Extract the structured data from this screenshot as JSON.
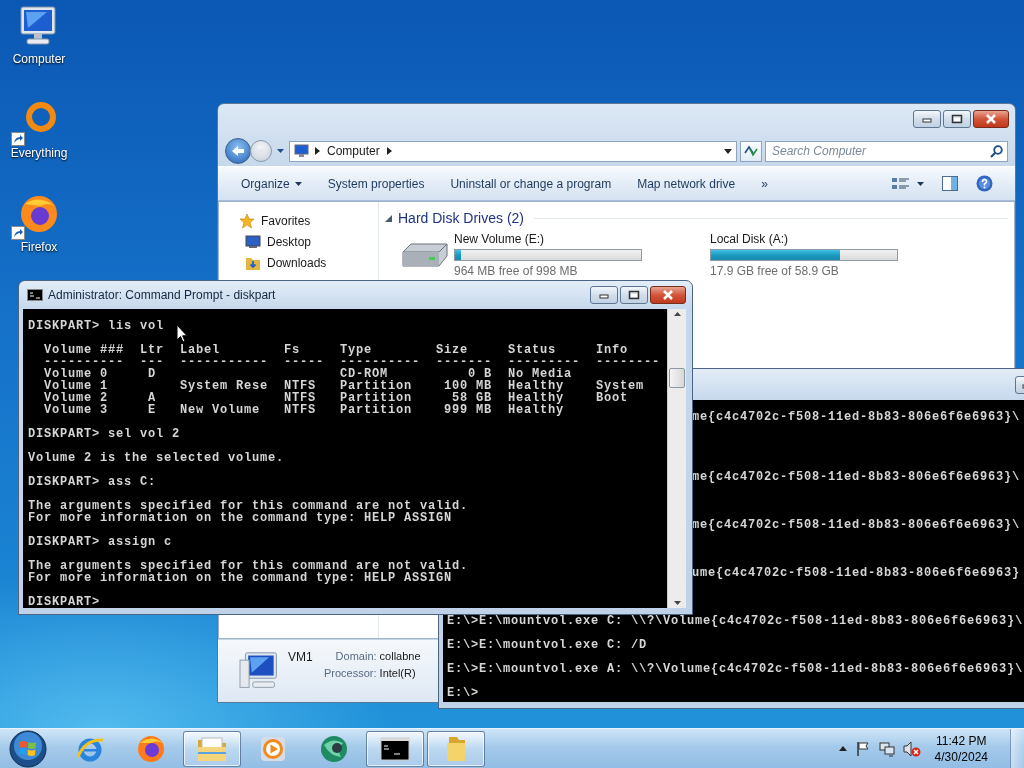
{
  "desktop_icons": [
    {
      "label": "Computer",
      "kind": "computer",
      "shortcut": false
    },
    {
      "label": "Everything",
      "kind": "everything",
      "shortcut": true
    },
    {
      "label": "Firefox",
      "kind": "firefox",
      "shortcut": true
    }
  ],
  "explorer": {
    "breadcrumbs": [
      "Computer"
    ],
    "search": {
      "placeholder": "Search Computer"
    },
    "toolbar": [
      {
        "label": "Organize",
        "dropdown": true
      },
      {
        "label": "System properties",
        "dropdown": false
      },
      {
        "label": "Uninstall or change a program",
        "dropdown": false
      },
      {
        "label": "Map network drive",
        "dropdown": false
      },
      {
        "label": "»",
        "dropdown": false
      }
    ],
    "toolbar_icons": [
      {
        "kind": "views"
      },
      {
        "kind": "preview-pane"
      },
      {
        "kind": "help"
      }
    ],
    "favorites": {
      "title": "Favorites",
      "items": [
        {
          "label": "Desktop",
          "kind": "desktop"
        },
        {
          "label": "Downloads",
          "kind": "downloads"
        }
      ]
    },
    "group": {
      "title": "Hard Disk Drives (2)",
      "expanded": true
    },
    "drives": [
      {
        "name": "New Volume (E:)",
        "icon": true,
        "level": 0.034,
        "free": "964 MB free of 998 MB"
      },
      {
        "name": "Local Disk (A:)",
        "icon": false,
        "level": 0.696,
        "free": "17.9 GB free of 58.9 GB"
      }
    ],
    "details": {
      "name": "VM1",
      "fields": [
        {
          "label": "Domain:",
          "value": "collabne"
        },
        {
          "label": "Processor:",
          "value": "Intel(R)"
        }
      ]
    }
  },
  "back_console": {
    "partial_lines": [
      "me{c4c4702c-f508-11ed-8b83-806e6f6e6963}\\",
      "me{c4c4702c-f508-11ed-8b83-806e6f6e6963}\\",
      "me{c4c4702c-f508-11ed-8b83-806e6f6e6963}\\",
      "ume{c4c4702c-f508-11ed-8b83-806e6f6e6963}"
    ],
    "lines": [
      "E:\\>E:\\mountvol.exe C: \\\\?\\Volume{c4c4702c-f508-11ed-8b83-806e6f6e6963}\\",
      "E:\\>E:\\mountvol.exe C: /D",
      "E:\\>E:\\mountvol.exe A: \\\\?\\Volume{c4c4702c-f508-11ed-8b83-806e6f6e6963}\\",
      "E:\\>"
    ]
  },
  "console": {
    "title": "Administrator:  Command Prompt - diskpart",
    "blocks": [
      [
        "DISKPART> lis vol"
      ],
      [
        "  Volume ###  Ltr  Label        Fs     Type        Size     Status     Info",
        "  ----------  ---  -----------  -----  ----------  -------  ---------  --------",
        "  Volume 0     D                       CD-ROM          0 B  No Media",
        "  Volume 1         System Rese  NTFS   Partition    100 MB  Healthy    System",
        "  Volume 2     A                NTFS   Partition     58 GB  Healthy    Boot",
        "  Volume 3     E   New Volume   NTFS   Partition    999 MB  Healthy"
      ],
      [
        "DISKPART> sel vol 2"
      ],
      [
        "Volume 2 is the selected volume."
      ],
      [
        "DISKPART> ass C:"
      ],
      [
        "The arguments specified for this command are not valid.",
        "For more information on the command type: HELP ASSIGN"
      ],
      [
        "DISKPART> assign c"
      ],
      [
        "The arguments specified for this command are not valid.",
        "For more information on the command type: HELP ASSIGN"
      ],
      [
        "DISKPART>"
      ]
    ]
  },
  "taskbar": {
    "items": [
      {
        "kind": "start"
      },
      {
        "kind": "ie",
        "open": false
      },
      {
        "kind": "firefox",
        "open": false
      },
      {
        "kind": "explorer",
        "open": true
      },
      {
        "kind": "media",
        "open": false
      },
      {
        "kind": "globe",
        "open": false
      },
      {
        "kind": "cmd",
        "open": true
      },
      {
        "kind": "folder",
        "open": true
      }
    ],
    "tray": [
      {
        "kind": "show-hidden"
      },
      {
        "kind": "flag"
      },
      {
        "kind": "network"
      },
      {
        "kind": "volume-muted"
      }
    ],
    "time": "11:42 PM",
    "date": "4/30/2024"
  }
}
